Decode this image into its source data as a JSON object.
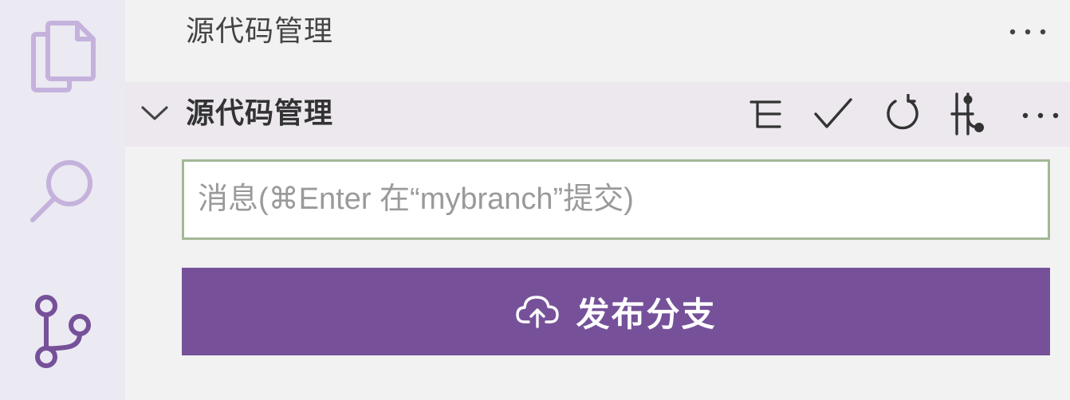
{
  "theme": {
    "accent": "#76519a",
    "activity_icon": "#c4b2dc",
    "activity_icon_active": "#76519a",
    "input_border": "#a3b897"
  },
  "activity_bar": {
    "items": [
      {
        "id": "explorer",
        "icon": "files-icon",
        "active": false
      },
      {
        "id": "search",
        "icon": "search-icon",
        "active": false
      },
      {
        "id": "scm",
        "icon": "source-control-icon",
        "active": true
      }
    ]
  },
  "view": {
    "title": "源代码管理",
    "more_icon": "ellipsis-icon"
  },
  "section": {
    "title": "源代码管理",
    "expanded": true,
    "toolbar": [
      {
        "id": "view-as-tree",
        "icon": "list-tree-icon"
      },
      {
        "id": "commit",
        "icon": "check-icon"
      },
      {
        "id": "refresh",
        "icon": "refresh-icon"
      },
      {
        "id": "graph",
        "icon": "git-graph-icon"
      },
      {
        "id": "more",
        "icon": "ellipsis-icon"
      }
    ]
  },
  "commit": {
    "value": "",
    "placeholder": "消息(⌘Enter 在“mybranch”提交)"
  },
  "publish": {
    "label": "发布分支",
    "icon": "cloud-upload-icon"
  }
}
